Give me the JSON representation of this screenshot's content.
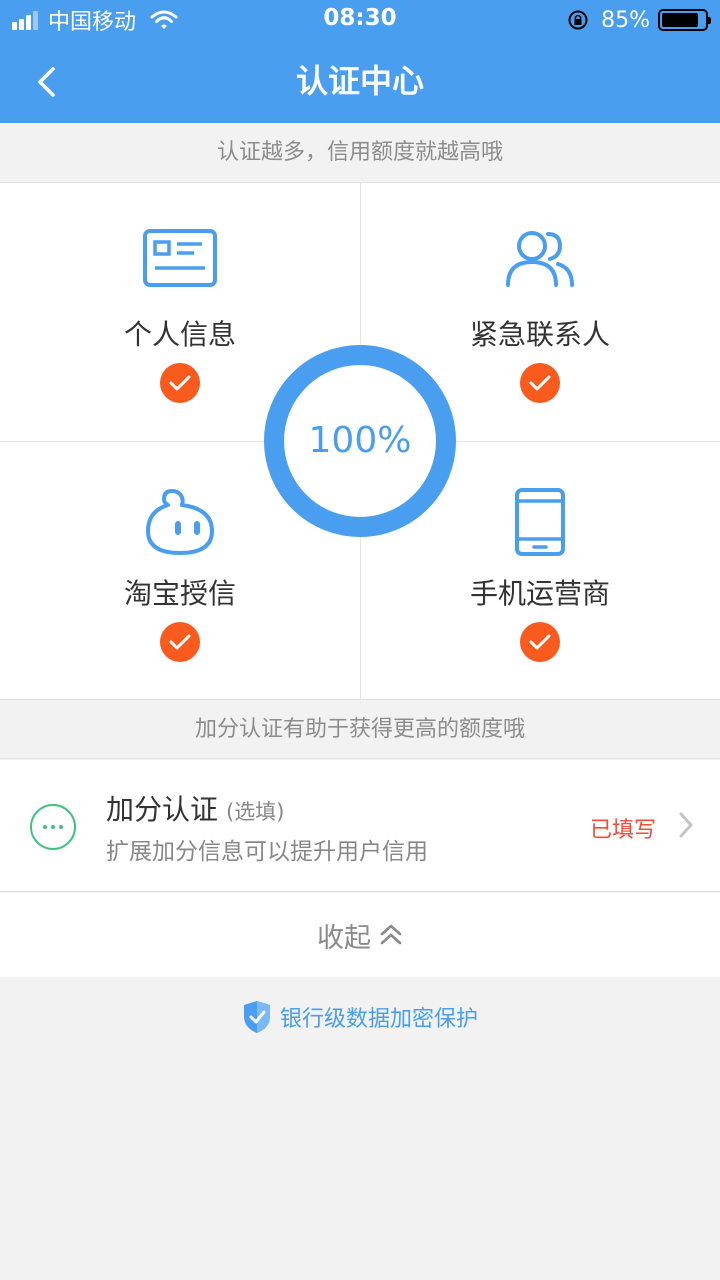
{
  "status_bar": {
    "carrier": "中国移动",
    "time": "08:30",
    "battery": "85%",
    "battery_level": 0.85
  },
  "nav": {
    "title": "认证中心",
    "back_icon": "chevron-left-icon"
  },
  "hint_top": "认证越多，信用额度就越高哦",
  "items": [
    {
      "label": "个人信息",
      "icon": "id-card-icon",
      "completed": true
    },
    {
      "label": "紧急联系人",
      "icon": "contacts-icon",
      "completed": true
    },
    {
      "label": "淘宝授信",
      "icon": "taobao-icon",
      "completed": true
    },
    {
      "label": "手机运营商",
      "icon": "phone-icon",
      "completed": true
    }
  ],
  "progress": {
    "text": "100%",
    "value": 1.0
  },
  "hint_bonus": "加分认证有助于获得更高的额度哦",
  "bonus": {
    "title": "加分认证",
    "optional": "(选填)",
    "desc": "扩展加分信息可以提升用户信用",
    "status": "已填写"
  },
  "collapse_label": "收起",
  "security_text": "银行级数据加密保护",
  "colors": {
    "primary": "#4a9ef0",
    "check": "#f95a1d",
    "status_red": "#f24b3a",
    "green": "#3fc27f"
  }
}
